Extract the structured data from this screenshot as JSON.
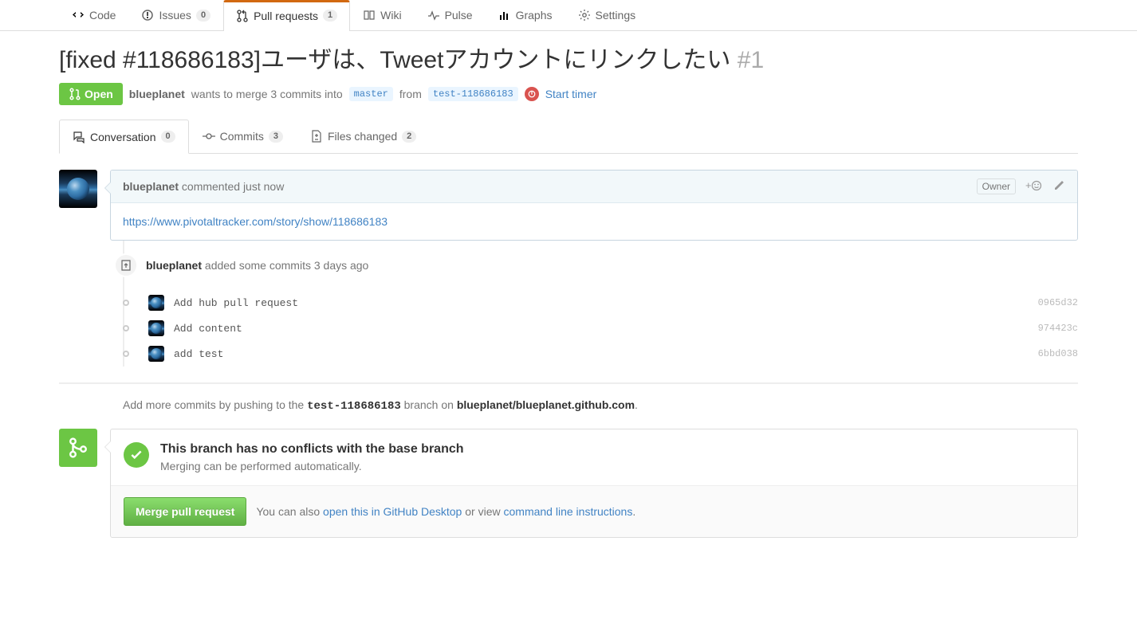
{
  "nav": {
    "code": "Code",
    "issues": "Issues",
    "issues_count": "0",
    "pulls": "Pull requests",
    "pulls_count": "1",
    "wiki": "Wiki",
    "pulse": "Pulse",
    "graphs": "Graphs",
    "settings": "Settings"
  },
  "pr": {
    "title": "[fixed #118686183]ユーザは、Tweetアカウントにリンクしたい",
    "number": "#1",
    "state": "Open",
    "author": "blueplanet",
    "merge_text": "wants to merge 3 commits into",
    "base": "master",
    "from_label": "from",
    "head": "test-118686183",
    "timer": "Start timer"
  },
  "subtabs": {
    "conversation": "Conversation",
    "conversation_count": "0",
    "commits": "Commits",
    "commits_count": "3",
    "files": "Files changed",
    "files_count": "2"
  },
  "comment": {
    "author": "blueplanet",
    "action": "commented just now",
    "owner_badge": "Owner",
    "body_link": "https://www.pivotaltracker.com/story/show/118686183"
  },
  "commits_event": {
    "author": "blueplanet",
    "text": "added some commits 3 days ago"
  },
  "commits": [
    {
      "msg": "Add hub pull request",
      "sha": "0965d32"
    },
    {
      "msg": "Add content",
      "sha": "974423c"
    },
    {
      "msg": "add test",
      "sha": "6bbd038"
    }
  ],
  "push_hint": {
    "prefix": "Add more commits by pushing to the",
    "branch": "test-118686183",
    "mid": "branch on",
    "repo": "blueplanet/blueplanet.github.com"
  },
  "merge": {
    "title": "This branch has no conflicts with the base branch",
    "sub": "Merging can be performed automatically.",
    "button": "Merge pull request",
    "also_prefix": "You can also",
    "desktop_link": "open this in GitHub Desktop",
    "or_view": "or view",
    "cli_link": "command line instructions"
  }
}
